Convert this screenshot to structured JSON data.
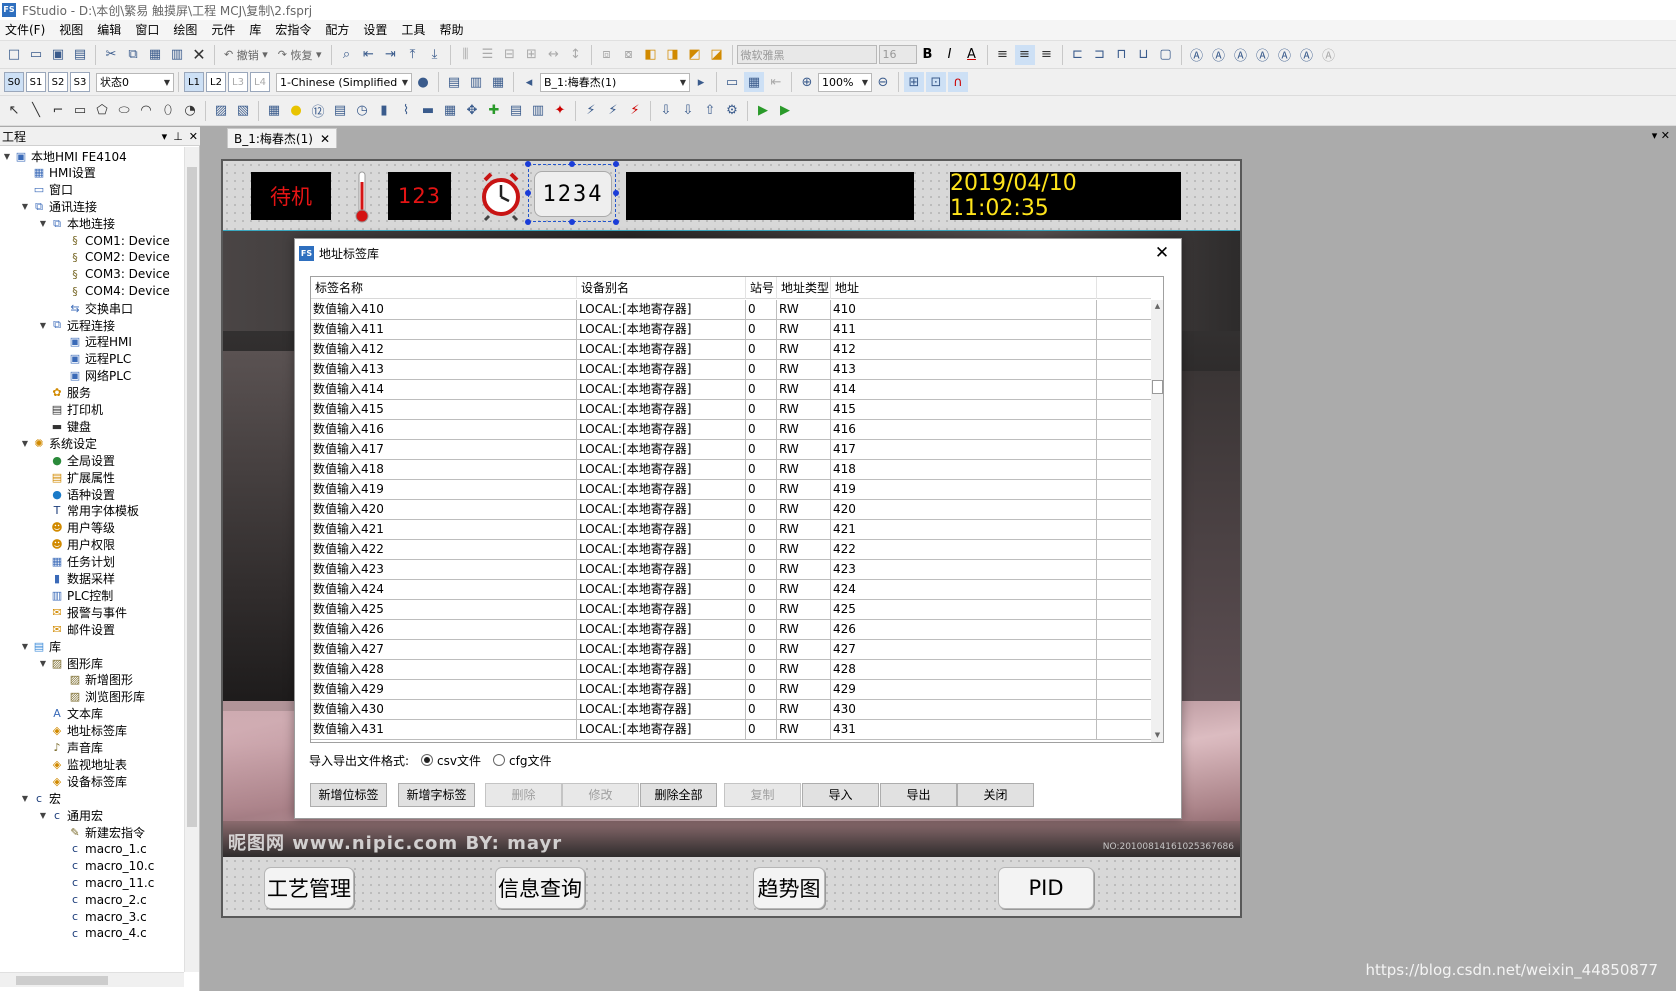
{
  "window": {
    "title": "FStudio - D:\\本创\\繁易  触摸屏\\工程 MCJ\\复制\\2.fsprj"
  },
  "menu": [
    "文件(F)",
    "视图",
    "编辑",
    "窗口",
    "绘图",
    "元件",
    "库",
    "宏指令",
    "配方",
    "设置",
    "工具",
    "帮助"
  ],
  "toolbar1": {
    "undo_label": "撤销",
    "redo_label": "恢复",
    "font_name": "微软雅黑",
    "font_size": "16",
    "bold": "B",
    "italic": "I",
    "font_color": "A"
  },
  "toolbar2": {
    "state_buttons": [
      "S0",
      "S1",
      "S2",
      "S3"
    ],
    "state_select": "状态0",
    "layer_buttons": [
      "L1",
      "L2",
      "L3",
      "L4"
    ],
    "language_select": "1-Chinese (Simplified)",
    "window_select": "B_1:梅春杰(1)",
    "zoom_select": "100%"
  },
  "left_panel": {
    "title": "工程",
    "tree": [
      {
        "label": "本地HMI FE4104",
        "icon": "monitor-icon",
        "level": 0,
        "expanded": true
      },
      {
        "label": "HMI设置",
        "icon": "settings-icon",
        "level": 1
      },
      {
        "label": "窗口",
        "icon": "window-icon",
        "level": 1
      },
      {
        "label": "通讯连接",
        "icon": "network-icon",
        "level": 1,
        "expanded": true
      },
      {
        "label": "本地连接",
        "icon": "network-icon",
        "level": 2,
        "expanded": true
      },
      {
        "label": "COM1:  Device",
        "icon": "cable-icon",
        "level": 3
      },
      {
        "label": "COM2:  Device",
        "icon": "cable-icon",
        "level": 3
      },
      {
        "label": "COM3:  Device",
        "icon": "cable-icon",
        "level": 3
      },
      {
        "label": "COM4:  Device",
        "icon": "cable-icon",
        "level": 3
      },
      {
        "label": "交换串口",
        "icon": "swap-icon",
        "level": 3
      },
      {
        "label": "远程连接",
        "icon": "network-icon",
        "level": 2,
        "expanded": true
      },
      {
        "label": "远程HMI",
        "icon": "monitor-icon",
        "level": 3
      },
      {
        "label": "远程PLC",
        "icon": "monitor-icon",
        "level": 3
      },
      {
        "label": "网络PLC",
        "icon": "monitor-icon",
        "level": 3
      },
      {
        "label": "服务",
        "icon": "service-icon",
        "level": 2
      },
      {
        "label": "打印机",
        "icon": "printer-icon",
        "level": 2
      },
      {
        "label": "键盘",
        "icon": "keyboard-icon",
        "level": 2
      },
      {
        "label": "系统设定",
        "icon": "gear-icon",
        "level": 1,
        "expanded": true
      },
      {
        "label": "全局设置",
        "icon": "globe-icon",
        "level": 2
      },
      {
        "label": "扩展属性",
        "icon": "properties-icon",
        "level": 2
      },
      {
        "label": "语种设置",
        "icon": "language-icon",
        "level": 2
      },
      {
        "label": "常用字体模板",
        "icon": "font-icon",
        "level": 2
      },
      {
        "label": "用户等级",
        "icon": "user-icon",
        "level": 2
      },
      {
        "label": "用户权限",
        "icon": "user-icon",
        "level": 2
      },
      {
        "label": "任务计划",
        "icon": "calendar-icon",
        "level": 2
      },
      {
        "label": "数据采样",
        "icon": "chart-icon",
        "level": 2
      },
      {
        "label": "PLC控制",
        "icon": "plc-icon",
        "level": 2
      },
      {
        "label": "报警与事件",
        "icon": "alarm-icon",
        "level": 2
      },
      {
        "label": "邮件设置",
        "icon": "mail-icon",
        "level": 2
      },
      {
        "label": "库",
        "icon": "library-icon",
        "level": 1,
        "expanded": true
      },
      {
        "label": "图形库",
        "icon": "image-icon",
        "level": 2,
        "expanded": true
      },
      {
        "label": "新增图形",
        "icon": "image-icon",
        "level": 3
      },
      {
        "label": "浏览图形库",
        "icon": "image-icon",
        "level": 3
      },
      {
        "label": "文本库",
        "icon": "text-icon",
        "level": 2
      },
      {
        "label": "地址标签库",
        "icon": "tag-icon",
        "level": 2
      },
      {
        "label": "声音库",
        "icon": "sound-icon",
        "level": 2
      },
      {
        "label": "监视地址表",
        "icon": "tag-icon",
        "level": 2
      },
      {
        "label": "设备标签库",
        "icon": "tag-icon",
        "level": 2
      },
      {
        "label": "宏",
        "icon": "macro-icon",
        "level": 1,
        "expanded": true
      },
      {
        "label": "通用宏",
        "icon": "macro-icon",
        "level": 2,
        "expanded": true
      },
      {
        "label": "新建宏指令",
        "icon": "macro-new-icon",
        "level": 3
      },
      {
        "label": "macro_1.c",
        "icon": "c-file-icon",
        "level": 3
      },
      {
        "label": "macro_10.c",
        "icon": "c-file-icon",
        "level": 3
      },
      {
        "label": "macro_11.c",
        "icon": "c-file-icon",
        "level": 3
      },
      {
        "label": "macro_2.c",
        "icon": "c-file-icon",
        "level": 3
      },
      {
        "label": "macro_3.c",
        "icon": "c-file-icon",
        "level": 3
      },
      {
        "label": "macro_4.c",
        "icon": "c-file-icon",
        "level": 3
      }
    ]
  },
  "doc_tab": {
    "label": "B_1:梅春杰(1)"
  },
  "hmi": {
    "status": "待机",
    "number": "123",
    "numpad": "1234",
    "datetime": "2019/04/10 11:02:35",
    "watermark": "昵图网 www.nipic.com    BY: mayr",
    "watermark_id": "NO:20100814161025367686",
    "buttons": [
      "工艺管理",
      "信息查询",
      "趋势图",
      "PID"
    ]
  },
  "dialog": {
    "title": "地址标签库",
    "columns": [
      "标签名称",
      "设备别名",
      "站号",
      "地址类型",
      "地址"
    ],
    "rows": [
      [
        "数值输入410",
        "LOCAL:[本地寄存器]",
        "0",
        "RW",
        "410"
      ],
      [
        "数值输入411",
        "LOCAL:[本地寄存器]",
        "0",
        "RW",
        "411"
      ],
      [
        "数值输入412",
        "LOCAL:[本地寄存器]",
        "0",
        "RW",
        "412"
      ],
      [
        "数值输入413",
        "LOCAL:[本地寄存器]",
        "0",
        "RW",
        "413"
      ],
      [
        "数值输入414",
        "LOCAL:[本地寄存器]",
        "0",
        "RW",
        "414"
      ],
      [
        "数值输入415",
        "LOCAL:[本地寄存器]",
        "0",
        "RW",
        "415"
      ],
      [
        "数值输入416",
        "LOCAL:[本地寄存器]",
        "0",
        "RW",
        "416"
      ],
      [
        "数值输入417",
        "LOCAL:[本地寄存器]",
        "0",
        "RW",
        "417"
      ],
      [
        "数值输入418",
        "LOCAL:[本地寄存器]",
        "0",
        "RW",
        "418"
      ],
      [
        "数值输入419",
        "LOCAL:[本地寄存器]",
        "0",
        "RW",
        "419"
      ],
      [
        "数值输入420",
        "LOCAL:[本地寄存器]",
        "0",
        "RW",
        "420"
      ],
      [
        "数值输入421",
        "LOCAL:[本地寄存器]",
        "0",
        "RW",
        "421"
      ],
      [
        "数值输入422",
        "LOCAL:[本地寄存器]",
        "0",
        "RW",
        "422"
      ],
      [
        "数值输入423",
        "LOCAL:[本地寄存器]",
        "0",
        "RW",
        "423"
      ],
      [
        "数值输入424",
        "LOCAL:[本地寄存器]",
        "0",
        "RW",
        "424"
      ],
      [
        "数值输入425",
        "LOCAL:[本地寄存器]",
        "0",
        "RW",
        "425"
      ],
      [
        "数值输入426",
        "LOCAL:[本地寄存器]",
        "0",
        "RW",
        "426"
      ],
      [
        "数值输入427",
        "LOCAL:[本地寄存器]",
        "0",
        "RW",
        "427"
      ],
      [
        "数值输入428",
        "LOCAL:[本地寄存器]",
        "0",
        "RW",
        "428"
      ],
      [
        "数值输入429",
        "LOCAL:[本地寄存器]",
        "0",
        "RW",
        "429"
      ],
      [
        "数值输入430",
        "LOCAL:[本地寄存器]",
        "0",
        "RW",
        "430"
      ],
      [
        "数值输入431",
        "LOCAL:[本地寄存器]",
        "0",
        "RW",
        "431"
      ]
    ],
    "format_label": "导入导出文件格式:",
    "format_options": [
      {
        "label": "csv文件",
        "selected": true
      },
      {
        "label": "cfg文件",
        "selected": false
      }
    ],
    "buttons": [
      {
        "label": "新增位标签",
        "enabled": true
      },
      {
        "label": "新增字标签",
        "enabled": true
      },
      {
        "label": "删除",
        "enabled": false
      },
      {
        "label": "修改",
        "enabled": false
      },
      {
        "label": "删除全部",
        "enabled": true
      },
      {
        "label": "复制",
        "enabled": false
      },
      {
        "label": "导入",
        "enabled": true
      },
      {
        "label": "导出",
        "enabled": true
      },
      {
        "label": "关闭",
        "enabled": true
      }
    ]
  },
  "footer_url": "https://blog.csdn.net/weixin_44850877",
  "colors": {
    "status_text": "#e41414",
    "datetime_text": "#ffe41b",
    "canvas_bg": "#ababab",
    "hmi_dots": "#777777"
  }
}
